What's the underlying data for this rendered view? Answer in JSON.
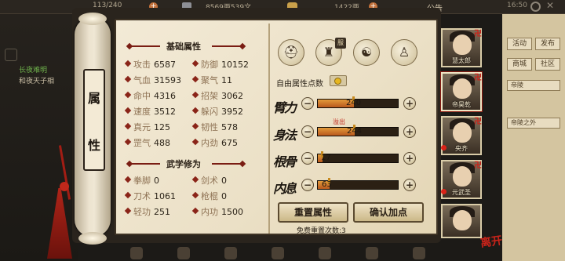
{
  "top_bar": {
    "stamina": "113/240",
    "silver": "8569两539文",
    "gold": "1422两",
    "notice": "公告",
    "time": "16:50"
  },
  "left_panel": {
    "news": [
      "长夜难明",
      "和夜天子相"
    ]
  },
  "right_panel": {
    "buttons": [
      "活动",
      "发布",
      "商城",
      "社区"
    ],
    "dropdown_label": "帝陵",
    "dropdown_selected": "帝陵之外"
  },
  "tab": {
    "chars": [
      "属",
      "性"
    ]
  },
  "basic_attributes": {
    "title": "基础属性",
    "rows": [
      [
        {
          "label": "攻击",
          "value": "6587"
        },
        {
          "label": "防御",
          "value": "10152"
        }
      ],
      [
        {
          "label": "气血",
          "value": "31593"
        },
        {
          "label": "聚气",
          "value": "11"
        }
      ],
      [
        {
          "label": "命中",
          "value": "4316"
        },
        {
          "label": "招架",
          "value": "3062"
        }
      ],
      [
        {
          "label": "速度",
          "value": "3512"
        },
        {
          "label": "躲闪",
          "value": "3952"
        }
      ],
      [
        {
          "label": "真元",
          "value": "125"
        },
        {
          "label": "韧性",
          "value": "578"
        }
      ],
      [
        {
          "label": "罡气",
          "value": "488"
        },
        {
          "label": "内劲",
          "value": "675"
        }
      ]
    ]
  },
  "martial_cultivation": {
    "title": "武学修为",
    "rows": [
      [
        {
          "label": "拳脚",
          "value": "0"
        },
        {
          "label": "剑术",
          "value": "0"
        }
      ],
      [
        {
          "label": "刀术",
          "value": "1061"
        },
        {
          "label": "枪棍",
          "value": "0"
        }
      ],
      [
        {
          "label": "轻功",
          "value": "251"
        },
        {
          "label": "内功",
          "value": "1500"
        }
      ]
    ]
  },
  "equipment": {
    "slots": [
      {
        "icon": "hat-icon",
        "glyph": "⛑"
      },
      {
        "icon": "armor-icon",
        "glyph": "♜",
        "badge": "服"
      },
      {
        "icon": "taiji-icon",
        "glyph": "☯"
      },
      {
        "icon": "figure-icon",
        "glyph": "♙"
      }
    ]
  },
  "allocation": {
    "free_points_label": "自由属性点数",
    "overflow_label": "溢出",
    "stats": [
      {
        "label": "臂力",
        "value": "240",
        "fill": 0.45
      },
      {
        "label": "身法",
        "value": "244",
        "fill": 0.46
      },
      {
        "label": "根骨",
        "value": "17",
        "fill": 0.06
      },
      {
        "label": "内息",
        "value": "63",
        "fill": 0.15
      }
    ],
    "reset_button": "重置属性",
    "confirm_button": "确认加点",
    "reset_count": "免费重置次数:3"
  },
  "characters": [
    {
      "name": "慧太郎",
      "mark": "卍"
    },
    {
      "name": "帝昊乾",
      "mark": "卍"
    },
    {
      "name": "央齐",
      "mark": "卍"
    },
    {
      "name": "元武圣",
      "mark": "卍"
    },
    {
      "name": "",
      "mark": ""
    }
  ],
  "leave_label": "离开",
  "colors": {
    "accent_red": "#c9231a",
    "bar_fill": "#d07a2c",
    "paper": "#efe6d0"
  }
}
